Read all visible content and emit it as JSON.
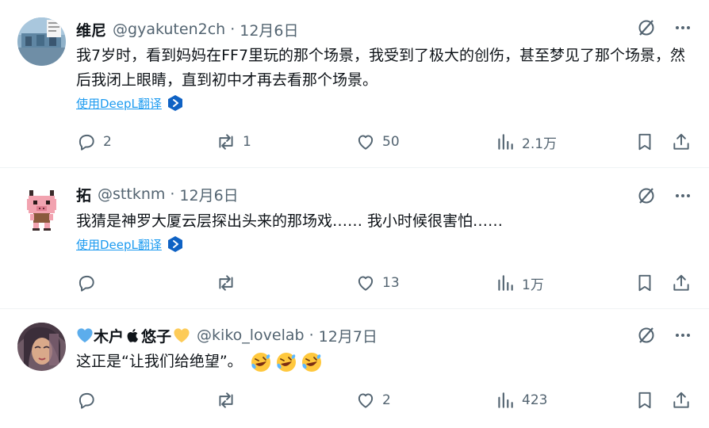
{
  "tweets": [
    {
      "name": "维尼",
      "handle": "@gyakuten2ch",
      "separator": "·",
      "date": "12月6日",
      "text": "我7岁时，看到妈妈在FF7里玩的那个场景，我受到了极大的创伤，甚至梦见了那个场景，然后我闭上眼睛，直到初中才再去看那个场景。",
      "translate_label": "使用DeepL翻译",
      "replies": "2",
      "retweets": "1",
      "likes": "50",
      "views": "2.1万"
    },
    {
      "name": "拓",
      "handle": "@sttknm",
      "separator": "·",
      "date": "12月6日",
      "text": "我猜是神罗大厦云层探出头来的那场戏…… 我小时候很害怕……",
      "translate_label": "使用DeepL翻译",
      "replies": "",
      "retweets": "",
      "likes": "13",
      "views": "1万"
    },
    {
      "name": "木户",
      "name_suffix": "悠子",
      "handle": "@kiko_lovelab",
      "separator": "·",
      "date": "12月7日",
      "text": "这正是“让我们给绝望”。",
      "replies": "",
      "retweets": "",
      "likes": "2",
      "views": "423"
    }
  ],
  "colors": {
    "accent": "#1d9bf0",
    "secondary_text": "#536471",
    "primary_text": "#0f1419",
    "divider": "#eff3f4"
  },
  "icons": [
    "reply-icon",
    "retweet-icon",
    "like-icon",
    "views-icon",
    "bookmark-icon",
    "share-icon",
    "grok-icon",
    "more-icon",
    "deepl-icon"
  ]
}
